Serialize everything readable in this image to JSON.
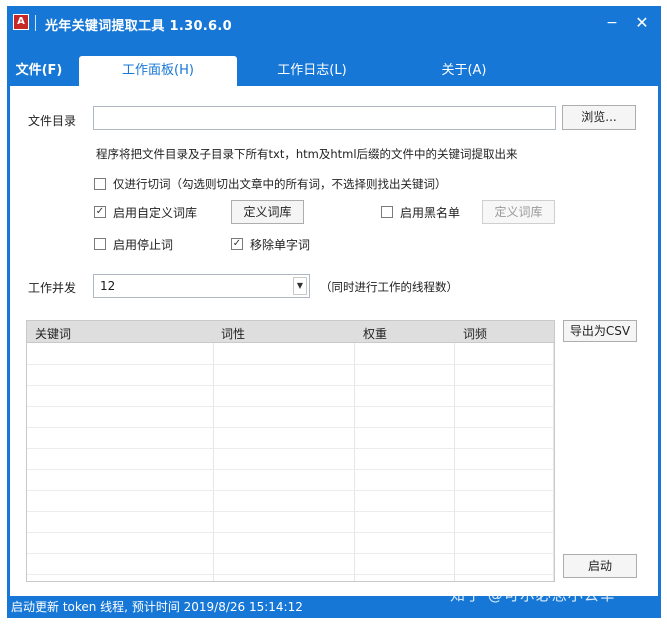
{
  "window": {
    "title": "光年关键词提取工具 1.30.6.0",
    "icon_letter": "A",
    "minimize_glyph": "−",
    "close_glyph": "✕"
  },
  "tabs": {
    "file_menu": "文件(F)",
    "workbench": "工作面板(H)",
    "work_log": "工作日志(L)",
    "about": "关于(A)"
  },
  "form": {
    "dir_label": "文件目录",
    "dir_value": "",
    "browse_button": "浏览...",
    "hint": "程序将把文件目录及子目录下所有txt，htm及html后缀的文件中的关键词提取出来",
    "only_segment": {
      "label": "仅进行切词（勾选则切出文章中的所有词，不选择则找出关键词）",
      "checked": false
    },
    "custom_dict": {
      "label": "启用自定义词库",
      "checked": true
    },
    "define_dict_button": "定义词库",
    "blacklist": {
      "label": "启用黑名单",
      "checked": false
    },
    "define_blacklist_button": "定义词库",
    "stopwords": {
      "label": "启用停止词",
      "checked": false
    },
    "remove_single": {
      "label": "移除单字词",
      "checked": true
    },
    "concurrency_label": "工作并发",
    "concurrency_value": "12",
    "concurrency_hint": "（同时进行工作的线程数）"
  },
  "table": {
    "columns": [
      "关键词",
      "词性",
      "权重",
      "词频"
    ],
    "rows": []
  },
  "export_button": "导出为CSV",
  "start_button": "启动",
  "status": {
    "text": "启动更新 token 线程, 预计时间 2019/8/26 15:14:12"
  },
  "watermark": "知乎 @可尔必思小公举",
  "colors": {
    "accent": "#1677d6",
    "header_bg": "#dedede"
  }
}
